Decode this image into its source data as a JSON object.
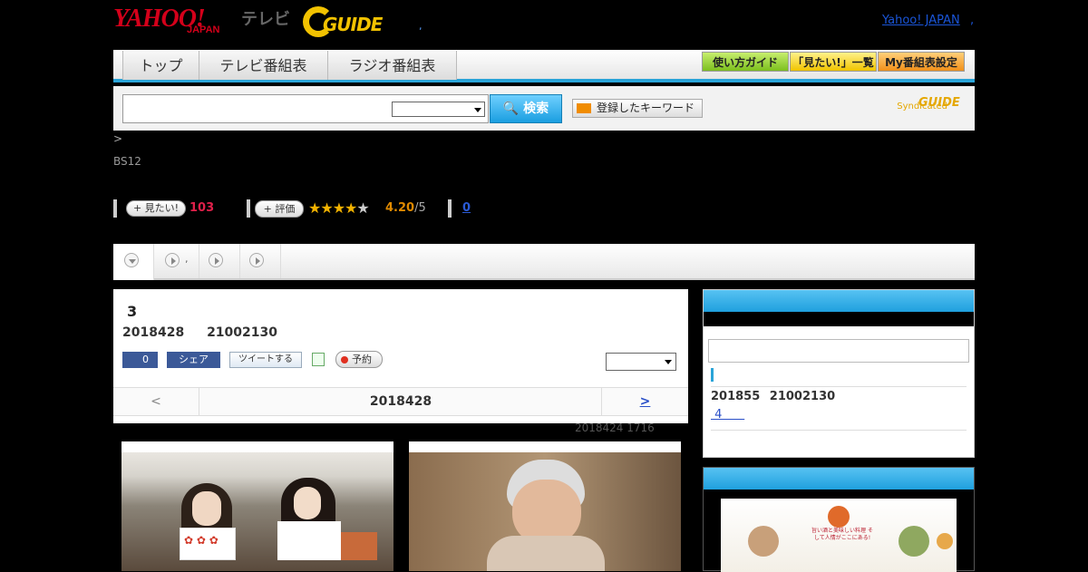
{
  "header": {
    "logo_yahoo": "YAHOO!",
    "logo_japan": "JAPAN",
    "logo_tv": "テレビ",
    "logo_gguide": "GUIDE",
    "dot": ",",
    "yahoo_japan_link": "Yahoo! JAPAN",
    "yahoo_japan_dot": ","
  },
  "nav": {
    "tabs": [
      "トップ",
      "テレビ番組表",
      "ラジオ番組表"
    ],
    "buttons": [
      "使い方ガイド",
      "「見たい!」一覧",
      "My番組表設定"
    ]
  },
  "search": {
    "button": "🔍 検索",
    "keyword_button": "登録したキーワード",
    "syndicated": "Syndicated",
    "gguide_mini": "GUIDE"
  },
  "breadcrumb": ">",
  "channel": "BS12",
  "stats": {
    "mitai_label": "+ 見たい!",
    "mitai_count": "103",
    "hyoka_label": "+ 評価",
    "stars_on": "★★★★",
    "stars_off": "★",
    "rating": "4.20",
    "rating_max": "/5",
    "zero": "0"
  },
  "tabs": {
    "tab2_text": ","
  },
  "program": {
    "title": "3",
    "date": "2018428 21002130",
    "fb_count": "0",
    "share": "シェア",
    "tweet": "ツイートする",
    "yoyaku": "予約",
    "prev": "<",
    "current_date": "2018428",
    "next": ">"
  },
  "updated": "2018424  1716",
  "sidebar": {
    "date": "201855 21002130",
    "link": " 4      "
  },
  "ad": {
    "text": "旨い酒と美味しい料理 そして人情がここにある!"
  },
  "colors": {
    "accent_blue": "#2aa4d8",
    "link_blue": "#2a4fc8",
    "red_count": "#e0204a",
    "rating_orange": "#e08a00"
  }
}
